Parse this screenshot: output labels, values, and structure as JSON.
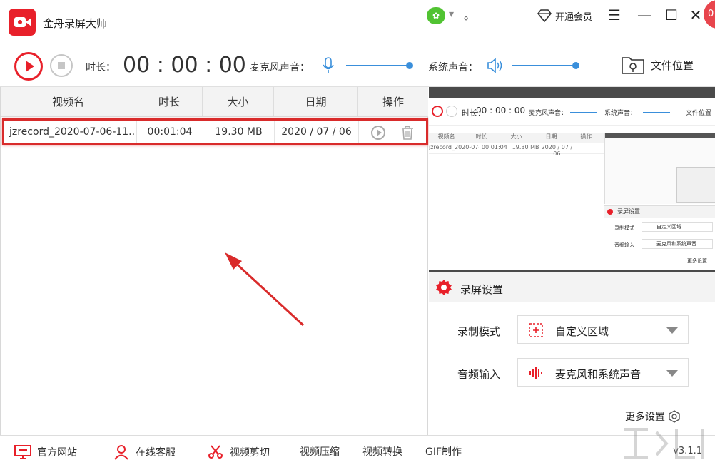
{
  "app": {
    "title": "金舟录屏大师"
  },
  "titlebar": {
    "user_dot": "。",
    "vip_label": "开通会员",
    "badge_text": "0"
  },
  "toolbar": {
    "duration_label": "时长：",
    "timer": "00 : 00 : 00",
    "mic_label": "麦克风声音：",
    "system_label": "系统声音：",
    "folder_label": "文件位置"
  },
  "table": {
    "columns": [
      "视频名",
      "时长",
      "大小",
      "日期",
      "操作"
    ],
    "rows": [
      {
        "name": "jzrecord_2020-07-06-11...",
        "duration": "00:01:04",
        "size": "19.30 MB",
        "date": "2020 / 07 / 06"
      }
    ]
  },
  "preview": {
    "duration_label": "时长：",
    "timer": "00 : 00 : 00",
    "mic_label": "麦克风声音：",
    "system_label": "系统声音：",
    "folder_label": "文件位置",
    "columns": [
      "视频名",
      "时长",
      "大小",
      "日期",
      "操作"
    ],
    "row": [
      "jzrecord_2020-07-06-11...",
      "00:01:04",
      "19.30 MB",
      "2020 / 07 / 06",
      ""
    ],
    "settings_title": "录屏设置",
    "mode_label": "录制模式",
    "mode_value": "自定义区域",
    "audio_label": "音频输入",
    "audio_value": "麦克风和系统声音",
    "more": "更多设置"
  },
  "settings": {
    "title": "录屏设置",
    "mode_label": "录制模式",
    "mode_value": "自定义区域",
    "audio_label": "音频输入",
    "audio_value": "麦克风和系统声音",
    "more_label": "更多设置"
  },
  "bottombar": {
    "website": "官方网站",
    "support": "在线客服",
    "cut": "视频剪切",
    "compress": "视频压缩",
    "convert": "视频转换",
    "gif": "GIF制作",
    "version": "v3.1.1"
  },
  "colors": {
    "accent": "#e8202a",
    "slider": "#3a8fdb",
    "highlight": "#d92b2b"
  }
}
